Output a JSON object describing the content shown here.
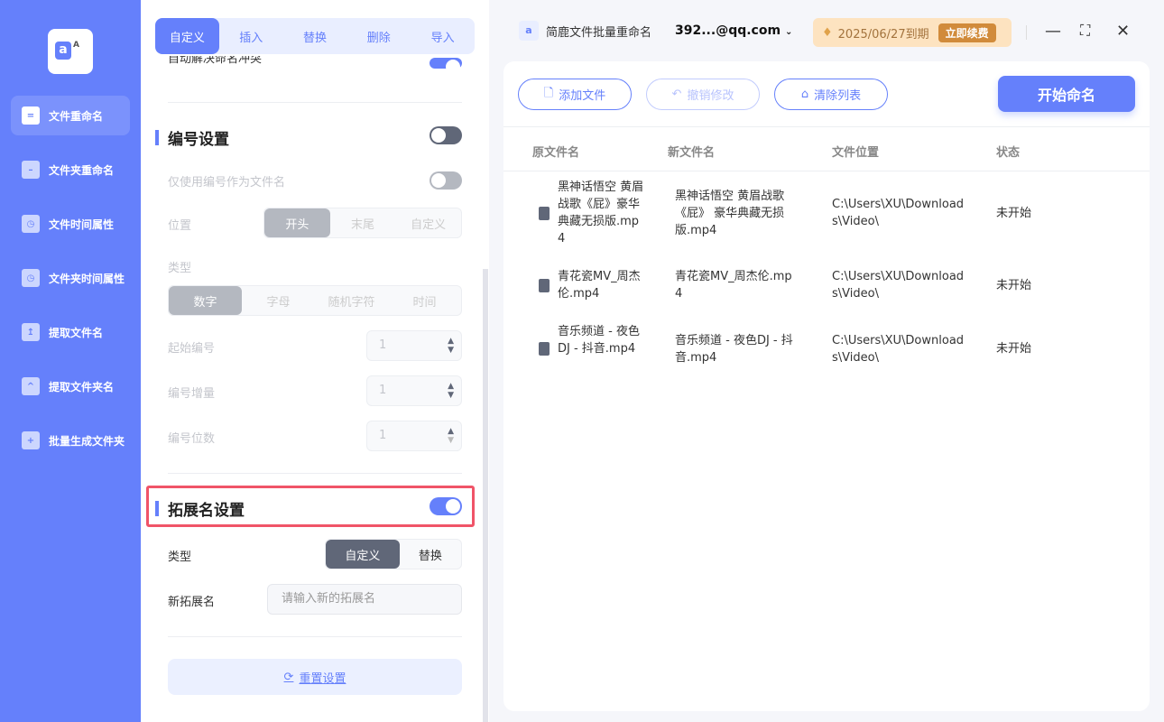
{
  "sidebar": {
    "items": [
      {
        "label": "文件重命名",
        "icon": "file-icon"
      },
      {
        "label": "文件夹重命名",
        "icon": "folder-icon"
      },
      {
        "label": "文件时间属性",
        "icon": "file-clock-icon"
      },
      {
        "label": "文件夹时间属性",
        "icon": "folder-clock-icon"
      },
      {
        "label": "提取文件名",
        "icon": "file-upload-icon"
      },
      {
        "label": "提取文件夹名",
        "icon": "folder-up-icon"
      },
      {
        "label": "批量生成文件夹",
        "icon": "folder-plus-icon"
      }
    ]
  },
  "tabs": [
    "自定义",
    "插入",
    "替换",
    "删除",
    "导入"
  ],
  "settings": {
    "partial_option": "自动解决命名冲突",
    "numbering": {
      "title": "编号设置",
      "only_number_label": "仅使用编号作为文件名",
      "position_label": "位置",
      "positions": [
        "开头",
        "末尾",
        "自定义"
      ],
      "type_label": "类型",
      "types": [
        "数字",
        "字母",
        "随机字符",
        "时间"
      ],
      "start_label": "起始编号",
      "start_value": "1",
      "step_label": "编号增量",
      "step_value": "1",
      "digits_label": "编号位数",
      "digits_value": "1"
    },
    "extension": {
      "title": "拓展名设置",
      "type_label": "类型",
      "types": [
        "自定义",
        "替换"
      ],
      "new_ext_label": "新拓展名",
      "new_ext_placeholder": "请输入新的拓展名"
    },
    "reset_label": "重置设置"
  },
  "header": {
    "app_title": "简鹿文件批量重命名",
    "account": "392...@qq.com",
    "expiry": "2025/06/27到期",
    "renew": "立即续费"
  },
  "toolbar": {
    "add": "添加文件",
    "undo": "撤销修改",
    "clear": "清除列表",
    "start": "开始命名"
  },
  "table": {
    "headers": [
      "原文件名",
      "新文件名",
      "文件位置",
      "状态"
    ],
    "rows": [
      {
        "orig": "黑神话悟空 黄眉战歌《屁》豪华典藏无损版.mp4",
        "new": "黑神话悟空 黄眉战歌《屁》 豪华典藏无损版.mp4",
        "path": "C:\\Users\\XU\\Downloads\\Video\\",
        "status": "未开始"
      },
      {
        "orig": "青花瓷MV_周杰伦.mp4",
        "new": "青花瓷MV_周杰伦.mp4",
        "path": "C:\\Users\\XU\\Downloads\\Video\\",
        "status": "未开始"
      },
      {
        "orig": "音乐频道 - 夜色DJ - 抖音.mp4",
        "new": "音乐频道 - 夜色DJ - 抖音.mp4",
        "path": "C:\\Users\\XU\\Downloads\\Video\\",
        "status": "未开始"
      }
    ]
  }
}
